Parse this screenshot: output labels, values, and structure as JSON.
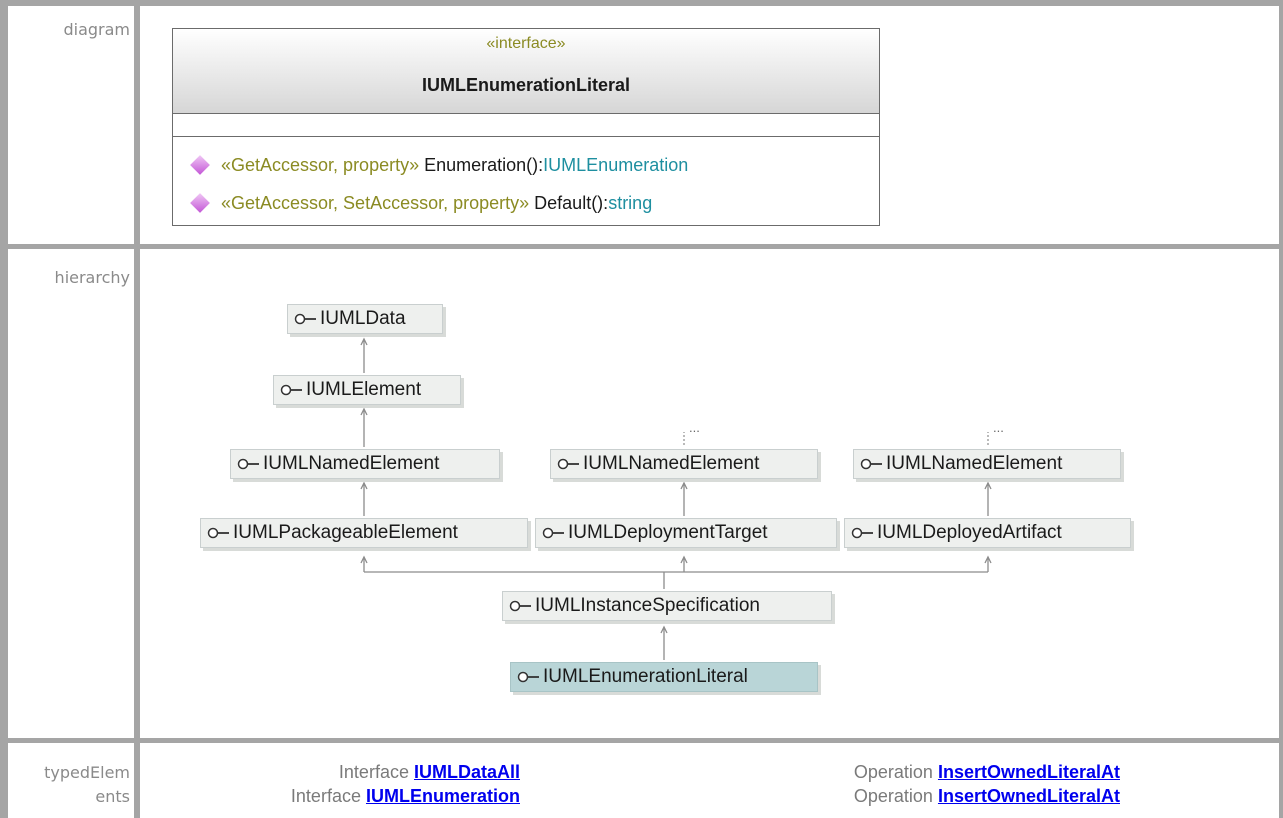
{
  "labels": {
    "diagram": "diagram",
    "hierarchy": "hierarchy",
    "typed_line1": "typedElem",
    "typed_line2": "ents"
  },
  "class_box": {
    "stereotype": "«interface»",
    "name": "IUMLEnumerationLiteral",
    "operations": [
      {
        "stereotype": "«GetAccessor, property»",
        "name": " Enumeration():",
        "type": "IUMLEnumeration"
      },
      {
        "stereotype": "«GetAccessor, SetAccessor, property»",
        "name": " Default():",
        "type": "string"
      }
    ]
  },
  "hierarchy": {
    "nodes": {
      "data": "IUMLData",
      "element": "IUMLElement",
      "named1": "IUMLNamedElement",
      "named2": "IUMLNamedElement",
      "named3": "IUMLNamedElement",
      "packageable": "IUMLPackageableElement",
      "deployment_target": "IUMLDeploymentTarget",
      "deployed_artifact": "IUMLDeployedArtifact",
      "instance_spec": "IUMLInstanceSpecification",
      "enum_literal": "IUMLEnumerationLiteral"
    },
    "ellipsis": "..."
  },
  "typed_elements": [
    {
      "kind": "Interface",
      "name": "IUMLDataAll"
    },
    {
      "kind": "Interface",
      "name": "IUMLEnumeration"
    },
    {
      "kind": "Operation",
      "name": "InsertOwnedLiteralAt"
    },
    {
      "kind": "Operation",
      "name": "InsertOwnedLiteralAt"
    }
  ],
  "colors": {
    "stereotype": "#8b8b23",
    "type": "#1e8fa0",
    "link": "#0000ee",
    "selected_node": "#b9d5d7",
    "node": "#eef0ee",
    "border": "#a5a5a5"
  }
}
